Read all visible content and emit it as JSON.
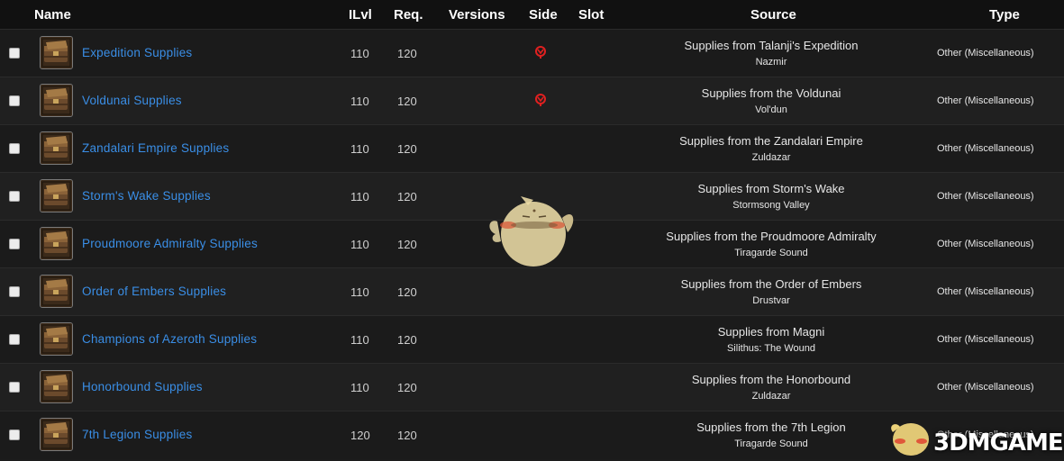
{
  "columns": {
    "name": "Name",
    "ilvl": "ILvl",
    "req": "Req.",
    "versions": "Versions",
    "side": "Side",
    "slot": "Slot",
    "source": "Source",
    "type": "Type"
  },
  "rows": [
    {
      "name": "Expedition Supplies",
      "ilvl": "110",
      "req": "120",
      "side": "horde",
      "source": "Supplies from Talanji's Expedition",
      "zone": "Nazmir",
      "type": "Other (Miscellaneous)"
    },
    {
      "name": "Voldunai Supplies",
      "ilvl": "110",
      "req": "120",
      "side": "horde",
      "source": "Supplies from the Voldunai",
      "zone": "Vol'dun",
      "type": "Other (Miscellaneous)"
    },
    {
      "name": "Zandalari Empire Supplies",
      "ilvl": "110",
      "req": "120",
      "side": "",
      "source": "Supplies from the Zandalari Empire",
      "zone": "Zuldazar",
      "type": "Other (Miscellaneous)"
    },
    {
      "name": "Storm's Wake Supplies",
      "ilvl": "110",
      "req": "120",
      "side": "",
      "source": "Supplies from Storm's Wake",
      "zone": "Stormsong Valley",
      "type": "Other (Miscellaneous)"
    },
    {
      "name": "Proudmoore Admiralty Supplies",
      "ilvl": "110",
      "req": "120",
      "side": "",
      "source": "Supplies from the Proudmoore Admiralty",
      "zone": "Tiragarde Sound",
      "type": "Other (Miscellaneous)"
    },
    {
      "name": "Order of Embers Supplies",
      "ilvl": "110",
      "req": "120",
      "side": "",
      "source": "Supplies from the Order of Embers",
      "zone": "Drustvar",
      "type": "Other (Miscellaneous)"
    },
    {
      "name": "Champions of Azeroth Supplies",
      "ilvl": "110",
      "req": "120",
      "side": "",
      "source": "Supplies from Magni",
      "zone": "Silithus: The Wound",
      "type": "Other (Miscellaneous)"
    },
    {
      "name": "Honorbound Supplies",
      "ilvl": "110",
      "req": "120",
      "side": "",
      "source": "Supplies from the Honorbound",
      "zone": "Zuldazar",
      "type": "Other (Miscellaneous)"
    },
    {
      "name": "7th Legion Supplies",
      "ilvl": "120",
      "req": "120",
      "side": "",
      "source": "Supplies from the 7th Legion",
      "zone": "Tiragarde Sound",
      "type": "Other (Miscellaneous)"
    }
  ],
  "icons": {
    "item": "supply-chest-icon",
    "side": "horde-icon"
  },
  "watermark": {
    "text": "3DMGAME"
  },
  "colors": {
    "link": "#3a8ee6",
    "horde": "#e02020",
    "header_bg": "#111111",
    "row_bg": "#1c1c1c"
  }
}
